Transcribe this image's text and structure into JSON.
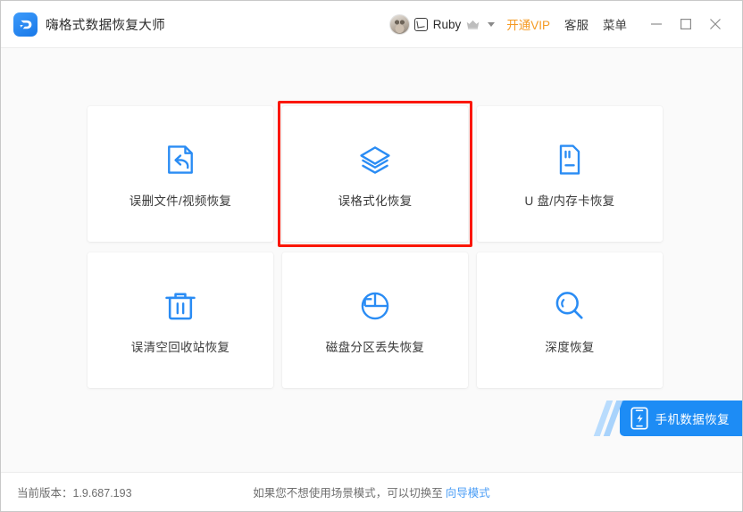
{
  "window": {
    "app_title": "嗨格式数据恢复大师",
    "logo_icon": "app-logo-d-icon"
  },
  "header": {
    "account": {
      "avatar_icon": "user-avatar",
      "badge_icon": "user-badge-icon",
      "username": "Ruby",
      "crown_icon": "crown-icon",
      "caret_icon": "chevron-down-icon"
    },
    "links": [
      {
        "label": "开通VIP",
        "name": "open-vip-link",
        "color": "#f59a23"
      },
      {
        "label": "客服",
        "name": "customer-service-link",
        "color": "#3c3c3c"
      },
      {
        "label": "菜单",
        "name": "menu-link",
        "color": "#3c3c3c"
      }
    ],
    "window_controls": [
      {
        "name": "minimize-button",
        "icon": "minimize-icon"
      },
      {
        "name": "maximize-button",
        "icon": "maximize-icon"
      },
      {
        "name": "close-button",
        "icon": "close-icon"
      }
    ]
  },
  "main": {
    "cards": [
      {
        "label": "误删文件/视频恢复",
        "icon": "file-restore-icon",
        "name": "card-deleted-file-video-recovery",
        "selected": false
      },
      {
        "label": "误格式化恢复",
        "icon": "layers-stack-icon",
        "name": "card-format-recovery",
        "selected": true
      },
      {
        "label": "U 盘/内存卡恢复",
        "icon": "memory-card-icon",
        "name": "card-usb-memorycard-recovery",
        "selected": false
      },
      {
        "label": "误清空回收站恢复",
        "icon": "trash-icon",
        "name": "card-recycle-bin-recovery",
        "selected": false
      },
      {
        "label": "磁盘分区丢失恢复",
        "icon": "disk-partition-icon",
        "name": "card-partition-loss-recovery",
        "selected": false
      },
      {
        "label": "深度恢复",
        "icon": "magnifier-icon",
        "name": "card-deep-recovery",
        "selected": false
      }
    ],
    "selection_highlight_color": "#fb1705"
  },
  "promo": {
    "label": "手机数据恢复",
    "icon": "phone-recovery-icon",
    "color": "#1d8cf5"
  },
  "footer": {
    "version_label": "当前版本：1.9.687.193",
    "hint_text": "如果您不想使用场景模式，可以切换至",
    "hint_link": "向导模式",
    "link_color": "#4a9df6"
  }
}
